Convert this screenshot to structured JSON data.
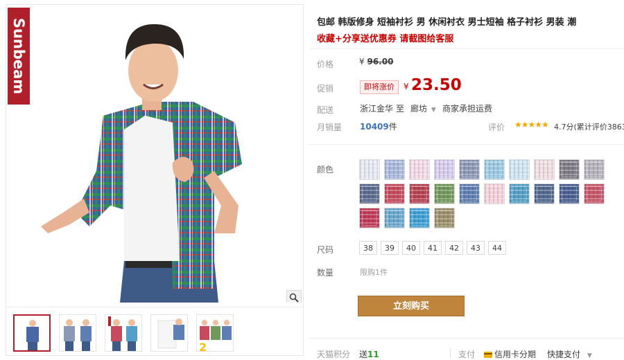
{
  "gallery": {
    "brand_logo": "Sunbeam",
    "thumbnails": [
      {
        "name": "thumb-1",
        "tag": ""
      },
      {
        "name": "thumb-2",
        "tag": ""
      },
      {
        "name": "thumb-3",
        "tag": ""
      },
      {
        "name": "thumb-4",
        "tag": ""
      },
      {
        "name": "thumb-5",
        "tag": "2"
      }
    ],
    "zoom_icon": "magnifier-icon"
  },
  "product": {
    "title": "包邮 韩版修身 短袖衬衫 男 休闲衬衣 男士短袖 格子衬衫 男装 潮",
    "promo": "收藏+分享送优惠券 请截图给客服"
  },
  "price": {
    "label": "价格",
    "currency": "¥",
    "original": "96.00",
    "promo_label": "促销",
    "badge": "即将涨价",
    "current": "23.50"
  },
  "shipping": {
    "label": "配送",
    "from": "浙江金华",
    "to_word": "至",
    "destination": "廊坊",
    "note": "商家承担运费"
  },
  "sales": {
    "label": "月销量",
    "count": "10409",
    "unit": "件",
    "rating_label": "评价",
    "stars": "★★★★★",
    "rating_text": "4.7分(累计评价3863"
  },
  "colors": {
    "label": "颜色",
    "swatches": [
      "#e8eaf4",
      "#a9b9dc",
      "#f6dbe6",
      "#d8cdee",
      "#8c99b6",
      "#9bcbe4",
      "#cfe6f5",
      "#f1dee3",
      "#7f7c86",
      "#b7b3bd",
      "#5a6b8f",
      "#c84a5e",
      "#b84150",
      "#6f9a5a",
      "#5f7fb4",
      "#f6d2dc",
      "#55a0c9",
      "#52698f",
      "#4a5e92",
      "#c9566a",
      "#c23a58",
      "#6aa9cf",
      "#3d9fd8",
      "#9c8f6a"
    ]
  },
  "sizes": {
    "label": "尺码",
    "options": [
      "38",
      "39",
      "40",
      "41",
      "42",
      "43",
      "44"
    ]
  },
  "quantity": {
    "label": "数量",
    "note": "限购1件"
  },
  "actions": {
    "buy": "立刻购买"
  },
  "footer": {
    "points_label": "天猫积分",
    "points_prefix": "送",
    "points_value": "11",
    "pay_label": "支付",
    "credit": "信用卡分期",
    "express": "快捷支付"
  }
}
